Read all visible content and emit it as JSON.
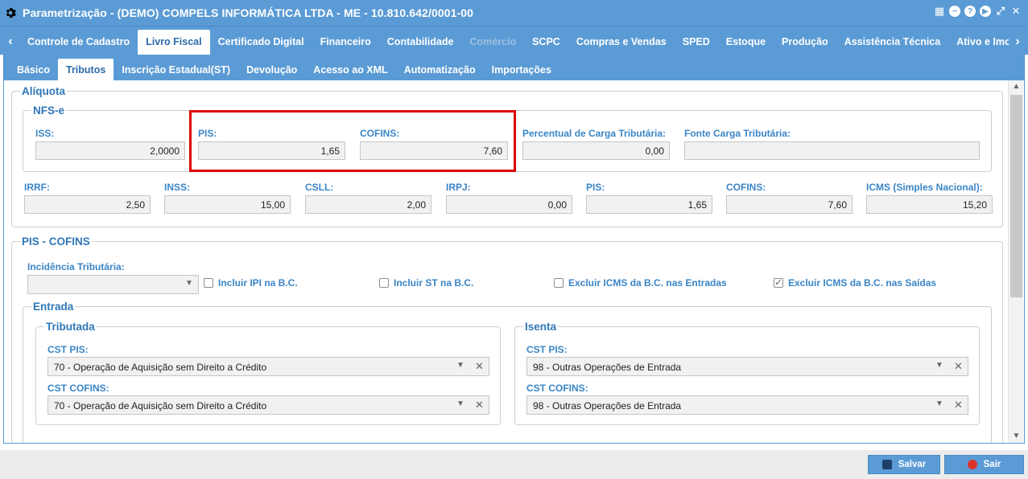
{
  "window": {
    "title": "Parametrização - (DEMO) COMPELS INFORMÁTICA LTDA - ME - 10.810.642/0001-00"
  },
  "main_tabs": [
    {
      "label": "Controle de Cadastro",
      "state": "normal"
    },
    {
      "label": "Livro Fiscal",
      "state": "active"
    },
    {
      "label": "Certificado Digital",
      "state": "normal"
    },
    {
      "label": "Financeiro",
      "state": "normal"
    },
    {
      "label": "Contabilidade",
      "state": "normal"
    },
    {
      "label": "Comércio",
      "state": "disabled"
    },
    {
      "label": "SCPC",
      "state": "normal"
    },
    {
      "label": "Compras e Vendas",
      "state": "normal"
    },
    {
      "label": "SPED",
      "state": "normal"
    },
    {
      "label": "Estoque",
      "state": "normal"
    },
    {
      "label": "Produção",
      "state": "normal"
    },
    {
      "label": "Assistência Técnica",
      "state": "normal"
    },
    {
      "label": "Ativo e Imobilização",
      "state": "normal"
    }
  ],
  "sub_tabs": [
    {
      "label": "Básico",
      "state": "normal"
    },
    {
      "label": "Tributos",
      "state": "active"
    },
    {
      "label": "Inscrição Estadual(ST)",
      "state": "normal"
    },
    {
      "label": "Devolução",
      "state": "normal"
    },
    {
      "label": "Acesso ao XML",
      "state": "normal"
    },
    {
      "label": "Automatização",
      "state": "normal"
    },
    {
      "label": "Importações",
      "state": "normal"
    }
  ],
  "aliquota": {
    "legend": "Alíquota",
    "nfse": {
      "legend": "NFS-e",
      "iss": {
        "label": "ISS:",
        "value": "2,0000"
      },
      "pis": {
        "label": "PIS:",
        "value": "1,65"
      },
      "cofins": {
        "label": "COFINS:",
        "value": "7,60"
      },
      "percentual": {
        "label": "Percentual de Carga Tributária:",
        "value": "0,00"
      },
      "fonte": {
        "label": "Fonte Carga Tributária:",
        "value": ""
      }
    },
    "irrf": {
      "label": "IRRF:",
      "value": "2,50"
    },
    "inss": {
      "label": "INSS:",
      "value": "15,00"
    },
    "csll": {
      "label": "CSLL:",
      "value": "2,00"
    },
    "irpj": {
      "label": "IRPJ:",
      "value": "0,00"
    },
    "pis": {
      "label": "PIS:",
      "value": "1,65"
    },
    "cofins": {
      "label": "COFINS:",
      "value": "7,60"
    },
    "icms_sn": {
      "label": "ICMS (Simples Nacional):",
      "value": "15,20"
    }
  },
  "pis_cofins": {
    "legend": "PIS - COFINS",
    "incidencia": {
      "label": "Incidência Tributária:",
      "value": ""
    },
    "checks": {
      "incluir_ipi": {
        "label": "Incluir IPI na B.C.",
        "checked": false
      },
      "incluir_st": {
        "label": "Incluir ST na B.C.",
        "checked": false
      },
      "excluir_icms_entradas": {
        "label": "Excluir ICMS da B.C. nas Entradas",
        "checked": false
      },
      "excluir_icms_saidas": {
        "label": "Excluir ICMS da B.C. nas Saídas",
        "checked": true,
        "mark": "✓"
      }
    },
    "entrada": {
      "legend": "Entrada",
      "tributada": {
        "legend": "Tributada",
        "cst_pis": {
          "label": "CST PIS:",
          "value": "70 - Operação de Aquisição sem Direito a Crédito"
        },
        "cst_cofins": {
          "label": "CST COFINS:",
          "value": "70 - Operação de Aquisição sem Direito a Crédito"
        }
      },
      "isenta": {
        "legend": "Isenta",
        "cst_pis": {
          "label": "CST PIS:",
          "value": "98 - Outras Operações de Entrada"
        },
        "cst_cofins": {
          "label": "CST COFINS:",
          "value": "98 - Outras Operações de Entrada"
        }
      }
    }
  },
  "footer": {
    "save_label": "Salvar",
    "exit_label": "Sair"
  },
  "colors": {
    "accent": "#5b9bd5",
    "label": "#3a85c6",
    "highlight": "#dd0000"
  }
}
